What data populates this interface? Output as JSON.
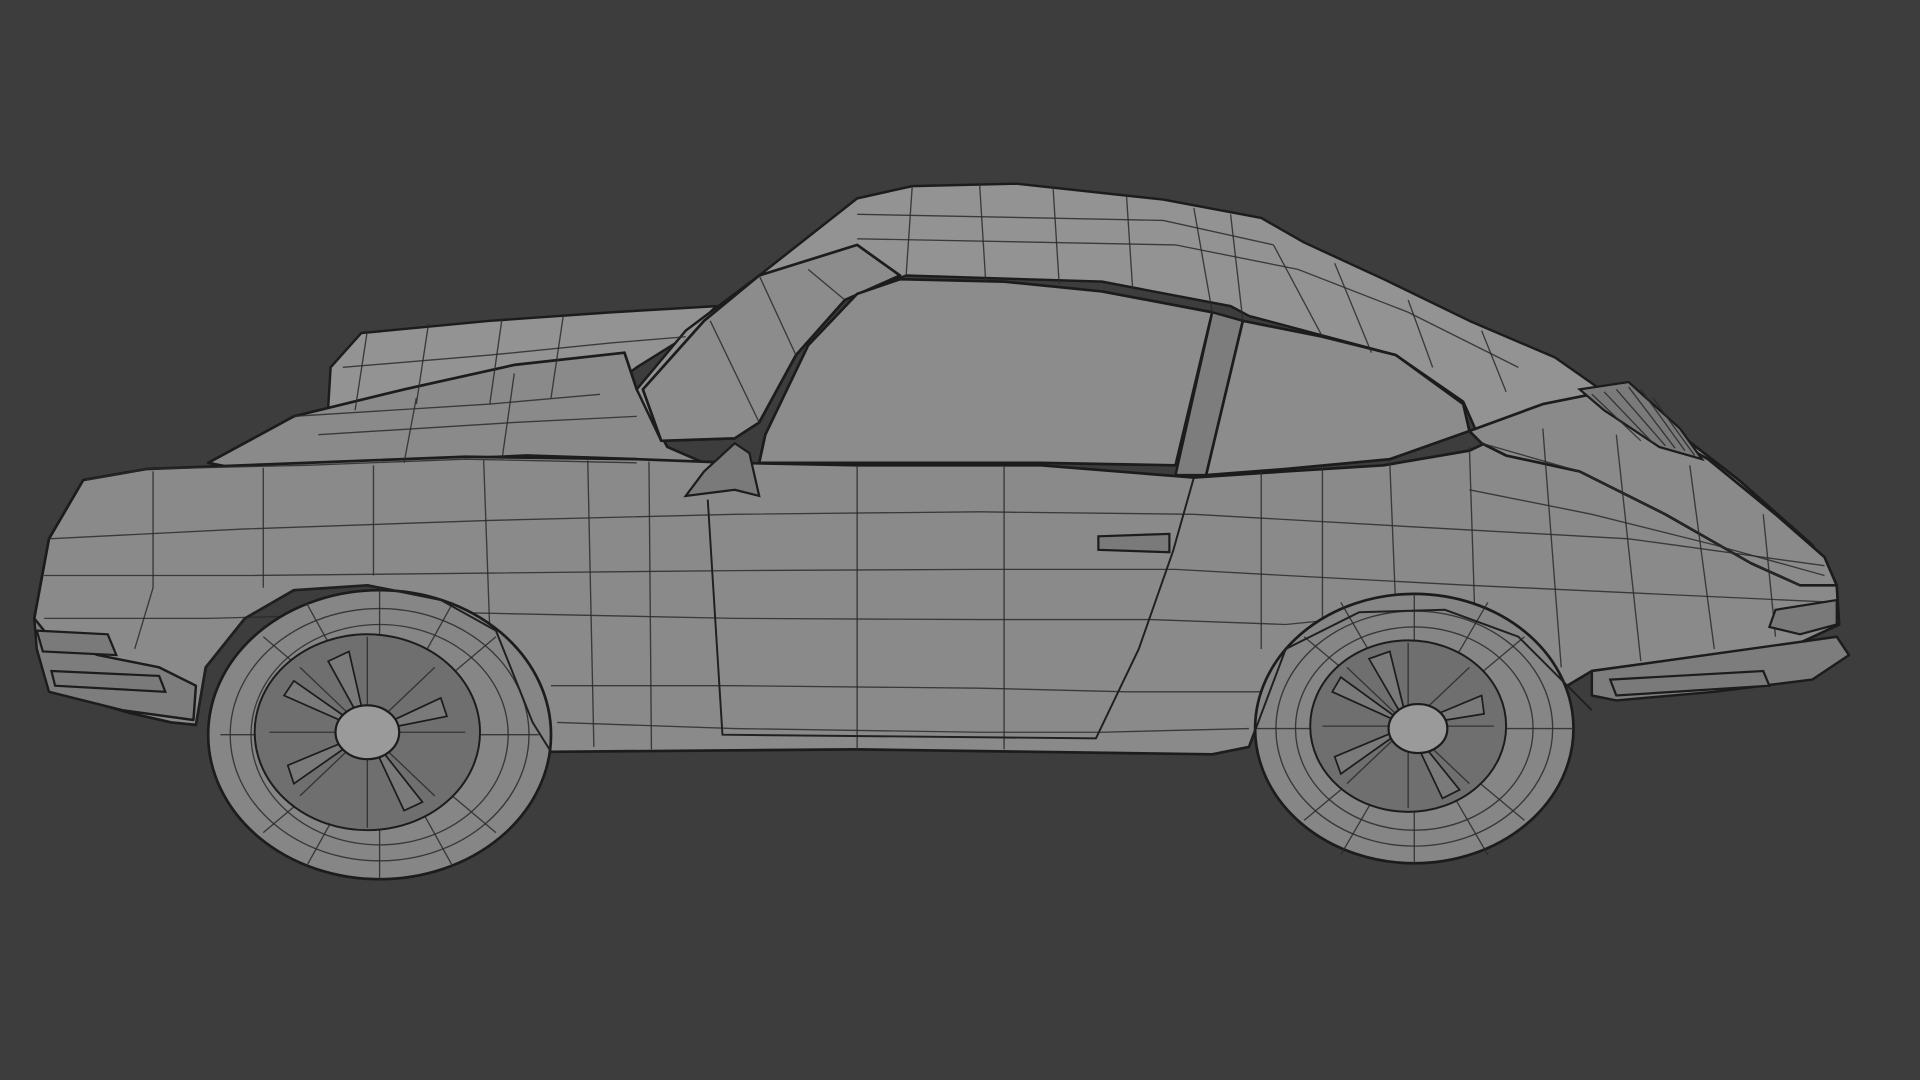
{
  "viewport": {
    "background": "#3d3d3d",
    "mesh_color": "#8a8a8a",
    "wire_color": "#1c1c1c"
  },
  "scene": {
    "object": "car-mesh",
    "display_mode": "wireframe-overlay",
    "view": "side"
  }
}
